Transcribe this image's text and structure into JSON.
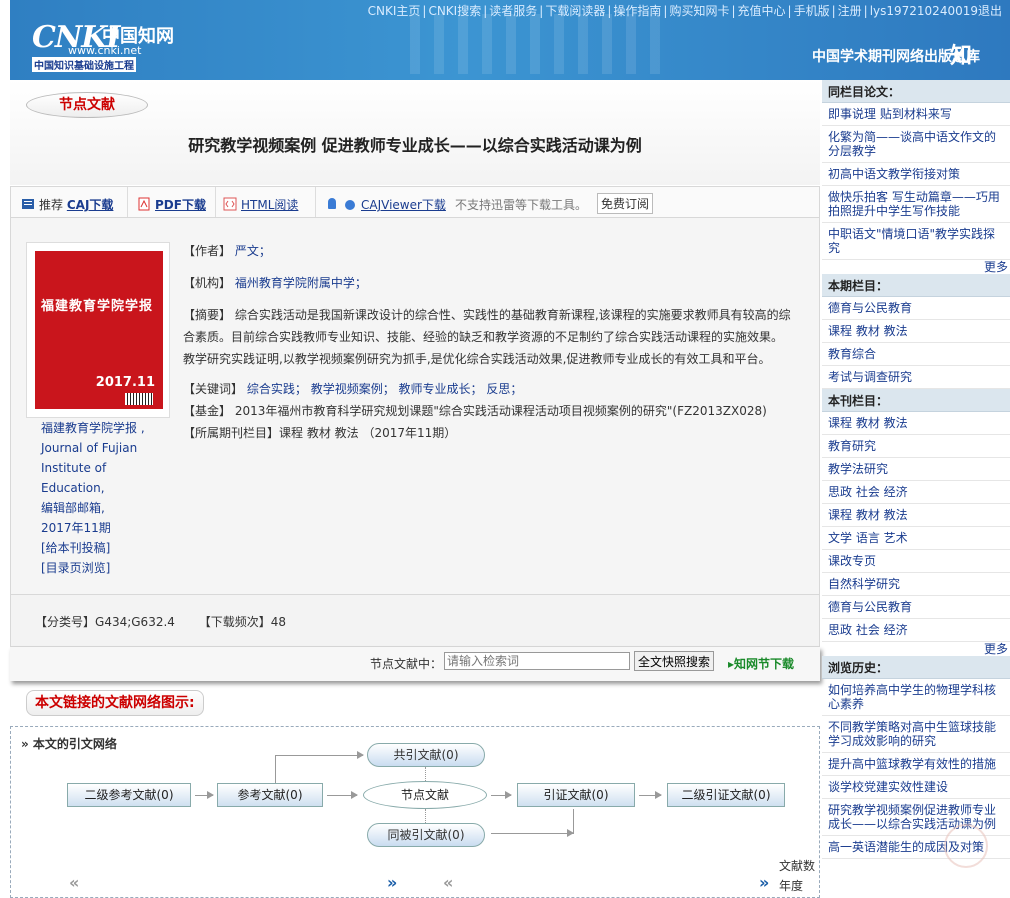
{
  "header": {
    "nav": [
      "CNKI主页",
      "CNKI搜索",
      "读者服务",
      "下载阅读器",
      "操作指南",
      "购买知网卡",
      "充值中心",
      "手机版",
      "注册",
      "lys197210240019退出"
    ],
    "logo_text": "CNKI",
    "logo_cn": "中国知网",
    "logo_url": "www.cnki.net",
    "logo_sub": "中国知识基础设施工程",
    "slogan": "中国学术期刊网络出版总库",
    "brand_mark": "知"
  },
  "article": {
    "section_label": "节点文献",
    "title": "研究教学视频案例 促进教师专业成长——以综合实践活动课为例",
    "downloads": {
      "recommend": "推荐",
      "caj": "CAJ下载",
      "pdf": "PDF下载",
      "html": "HTML阅读",
      "viewer": "CAJViewer下载",
      "note": "不支持迅雷等下载工具。",
      "subscribe": "免费订阅"
    },
    "author_label": "【作者】",
    "author": "严文；",
    "org_label": "【机构】",
    "org": "福州教育学院附属中学；",
    "abstract_label": "【摘要】",
    "abstract": "综合实践活动是我国新课改设计的综合性、实践性的基础教育新课程,该课程的实施要求教师具有较高的综合素质。目前综合实践教师专业知识、技能、经验的缺乏和教学资源的不足制约了综合实践活动课程的实施效果。教学研究实践证明,以教学视频案例研究为抓手,是优化综合实践活动效果,促进教师专业成长的有效工具和平台。",
    "keywords_label": "【关键词】",
    "keywords": [
      "综合实践；",
      "教学视频案例；",
      "教师专业成长；",
      "反思；"
    ],
    "fund_label": "【基金】",
    "fund": "2013年福州市教育科学研究规划课题\"综合实践活动课程活动项目视频案例的研究\"(FZ2013ZX028)",
    "column_label": "【所属期刊栏目】",
    "column": "课程 教材 教法 （2017年11期）",
    "journal": [
      "福建教育学院学报 ,",
      "Journal of Fujian",
      "Institute of Education,",
      "编辑部邮箱,",
      "2017年11期",
      "[给本刊投稿]",
      "[目录页浏览]"
    ],
    "cover_title": "福建教育学院学报",
    "cover_issue": "2017.11",
    "class_label": "【分类号】",
    "class_no": "G434;G632.4",
    "dl_label": "【下载频次】",
    "dl_count": "48"
  },
  "search": {
    "label": "节点文献中：",
    "placeholder": "请输入检索词",
    "button": "全文快照搜索",
    "link": "知网节下载"
  },
  "network": {
    "label": "本文链接的文献网络图示:",
    "title": "» 本文的引文网络",
    "nodes": {
      "co_cite": "共引文献(0)",
      "ref2": "二级参考文献(0)",
      "ref": "参考文献(0)",
      "center": "节点文献",
      "cite": "引证文献(0)",
      "cite2": "二级引证文献(0)",
      "co_cited": "同被引文献(0)"
    },
    "count_label": "文献数",
    "year_label": "年度",
    "prev": "«",
    "next": "»"
  },
  "sidebar": {
    "same_title": "同栏目论文：",
    "same_items": [
      "即事说理 贴到材料来写",
      "化繁为简——谈高中语文作文的分层教学",
      "初高中语文教学衔接对策",
      "做快乐拍客 写生动篇章——巧用拍照提升中学生写作技能",
      "中职语文\"情境口语\"教学实践探究"
    ],
    "more": "更多",
    "issue_title": "本期栏目：",
    "issue_items": [
      "德育与公民教育",
      "课程 教材 教法",
      "教育综合",
      "考试与调查研究"
    ],
    "journal_title": "本刊栏目：",
    "journal_items": [
      "课程 教材 教法",
      "教育研究",
      "教学法研究",
      "思政 社会 经济",
      "课程 教材 教法",
      "文学 语言 艺术",
      "课改专页",
      "自然科学研究",
      "德育与公民教育",
      "思政 社会 经济"
    ],
    "history_title": "浏览历史：",
    "history_items": [
      "如何培养高中学生的物理学科核心素养",
      "不同教学策略对高中生篮球技能学习成效影响的研究",
      "提升高中篮球教学有效性的措施",
      "谈学校党建实效性建设",
      "研究教学视频案例促进教师专业成长——以综合实践活动课为例",
      "高一英语潜能生的成因及对策"
    ]
  }
}
